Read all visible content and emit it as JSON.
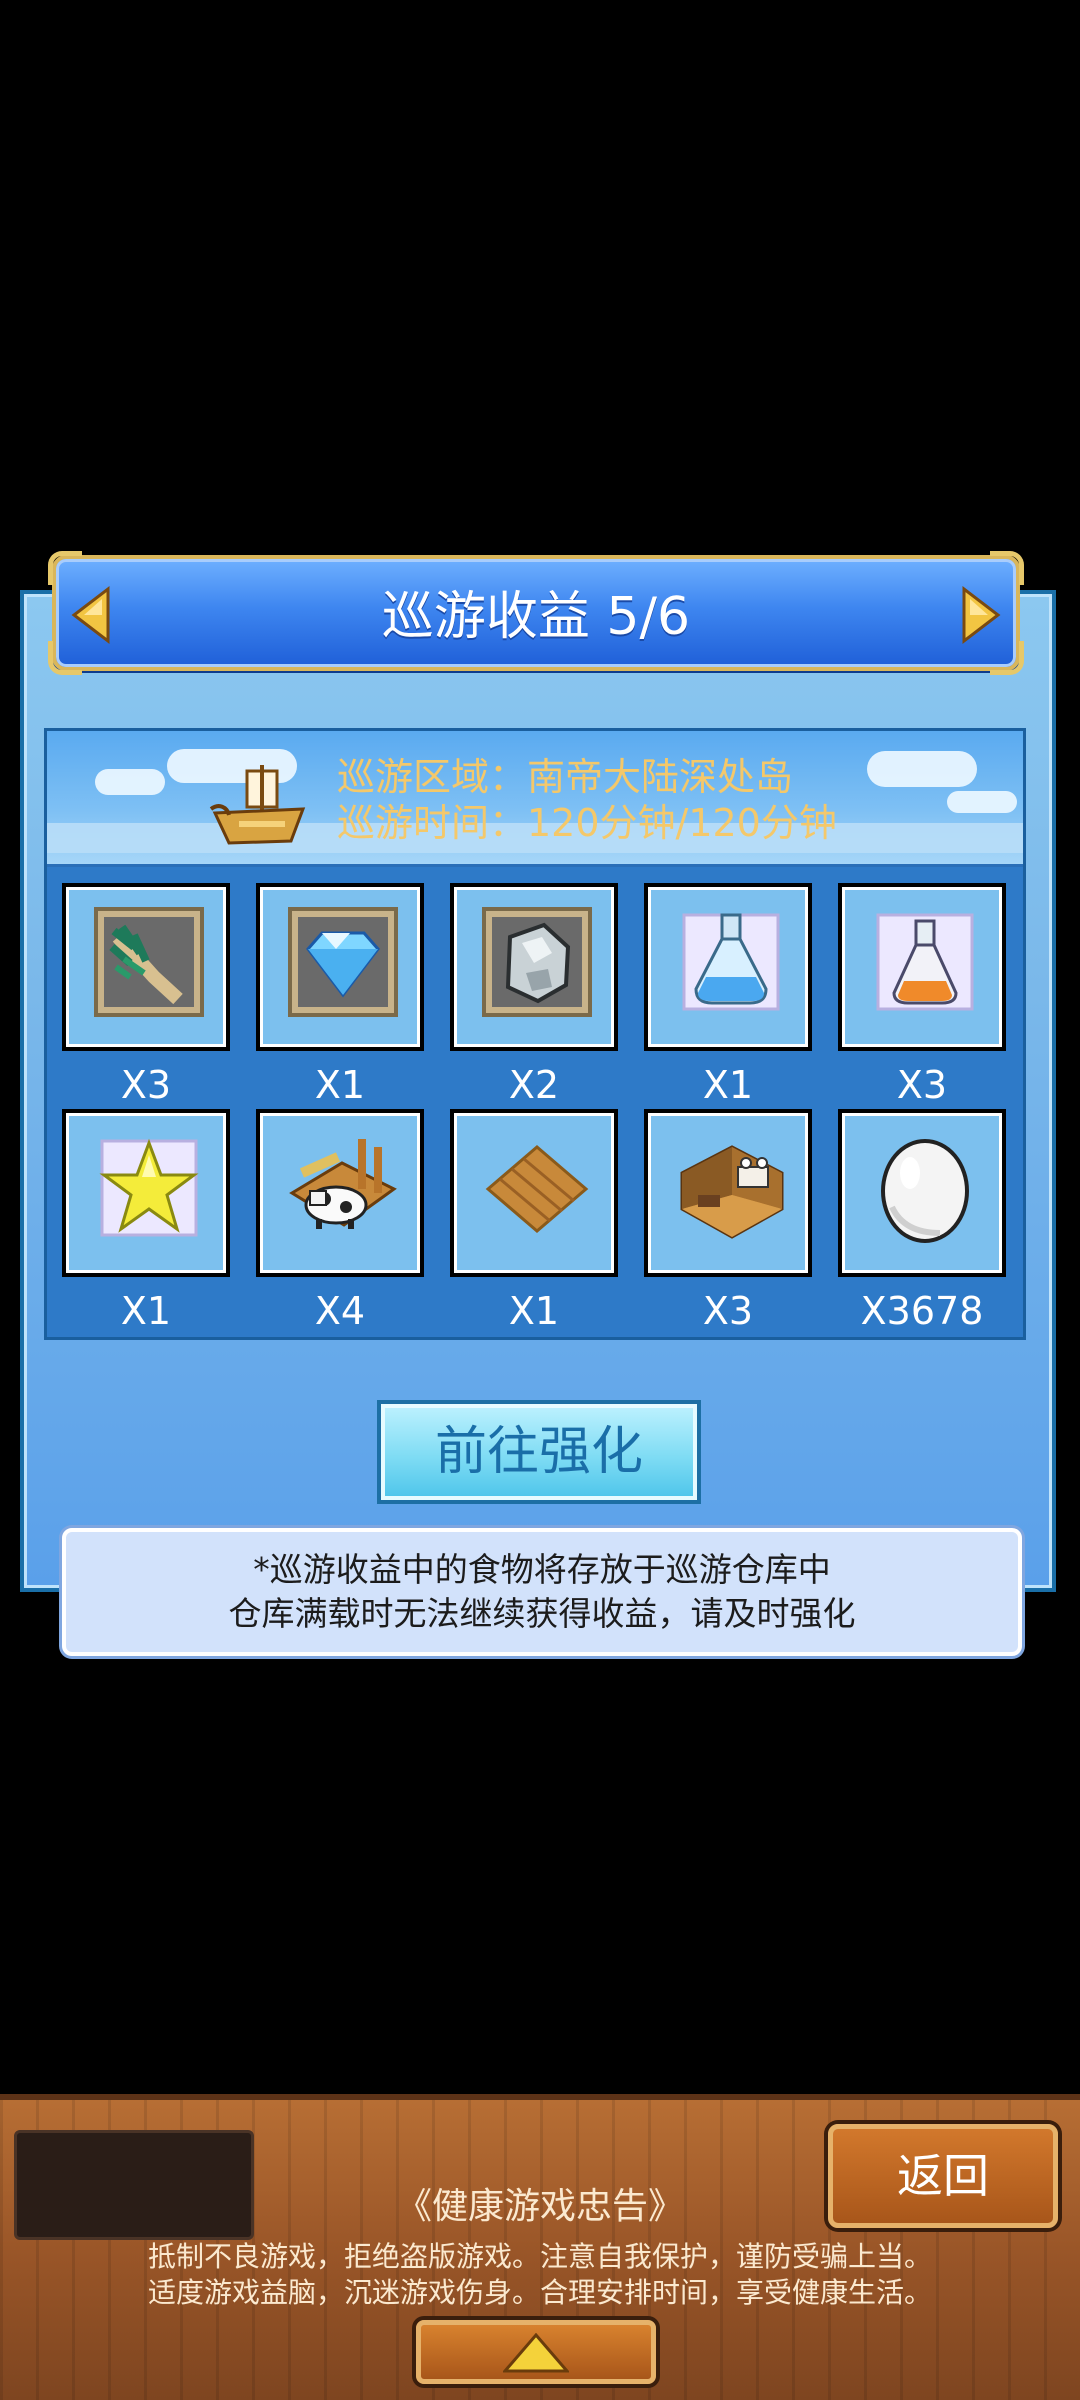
{
  "header": {
    "title": "巡游收益 5/6"
  },
  "info": {
    "region": "巡游区域：南帝大陆深处岛",
    "time": "巡游时间：120分钟/120分钟"
  },
  "rewards": [
    {
      "icon": "herb-bundle-icon",
      "qty": "X3"
    },
    {
      "icon": "diamond-icon",
      "qty": "X1"
    },
    {
      "icon": "ore-rock-icon",
      "qty": "X2"
    },
    {
      "icon": "blue-potion-icon",
      "qty": "X1"
    },
    {
      "icon": "orange-potion-icon",
      "qty": "X3"
    },
    {
      "icon": "star-icon",
      "qty": "X1"
    },
    {
      "icon": "cow-pen-icon",
      "qty": "X4"
    },
    {
      "icon": "wooden-floor-icon",
      "qty": "X1"
    },
    {
      "icon": "barn-room-icon",
      "qty": "X3"
    },
    {
      "icon": "egg-icon",
      "qty": "X3678"
    }
  ],
  "enhance_button": "前往强化",
  "notes": [
    "*巡游收益中的食物将存放于巡游仓库中",
    "仓库满载时无法继续获得收益，请及时强化"
  ],
  "bottom": {
    "back_label": "返回",
    "advice_title": "《健康游戏忠告》",
    "advice_lines": [
      "抵制不良游戏，拒绝盗版游戏。注意自我保护，谨防受骗上当。",
      "适度游戏益脑，沉迷游戏伤身。合理安排时间，享受健康生活。"
    ]
  },
  "colors": {
    "panel": "#7ab8ea",
    "header": "#3e86f0",
    "info_text": "#f4c86a",
    "gold_trim": "#d9b65a",
    "wood": "#9a5628"
  }
}
